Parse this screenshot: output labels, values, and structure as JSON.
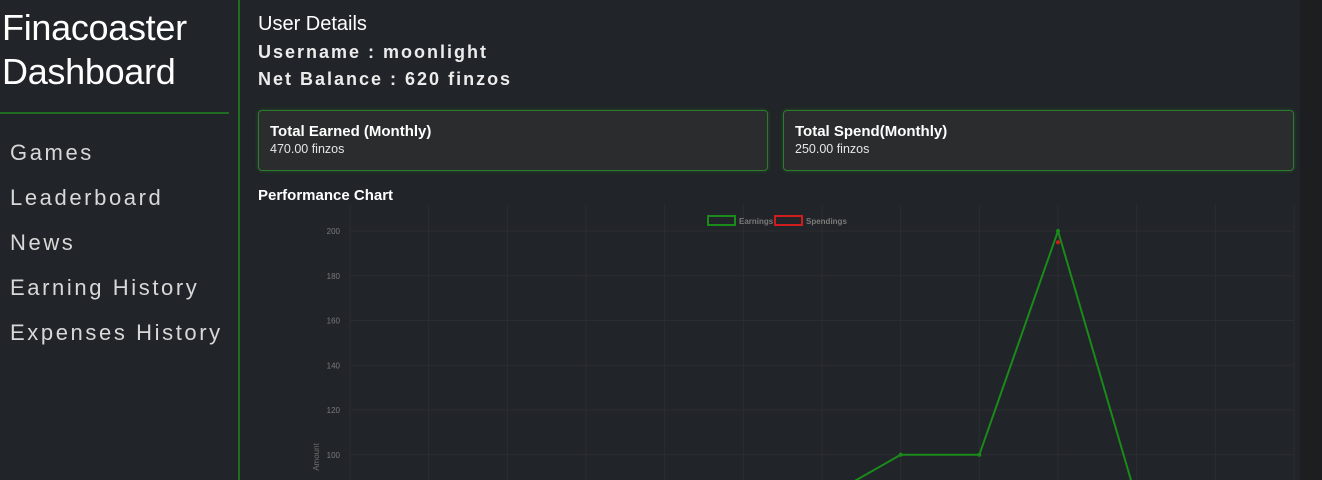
{
  "sidebar": {
    "brand_line1": "Finacoaster",
    "brand_line2": "Dashboard",
    "nav_items": [
      {
        "label": "Games"
      },
      {
        "label": "Leaderboard"
      },
      {
        "label": "News"
      },
      {
        "label": "Earning History"
      },
      {
        "label": "Expenses History"
      }
    ]
  },
  "user_details": {
    "title": "User Details",
    "username_line": "Username : moonlight",
    "balance_line": "Net Balance : 620 finzos"
  },
  "cards": {
    "earned": {
      "title": "Total Earned (Monthly)",
      "value": "470.00 finzos"
    },
    "spend": {
      "title": "Total Spend(Monthly)",
      "value": "250.00 finzos"
    }
  },
  "chart": {
    "title": "Performance Chart"
  },
  "colors": {
    "accent_green": "#1f6b1f",
    "earnings_line": "#1a8a1a",
    "spendings_line": "#d01c1c"
  },
  "chart_data": {
    "type": "line",
    "x": [
      0,
      1,
      2,
      3,
      4,
      5,
      6,
      7,
      8,
      9,
      10,
      11,
      12
    ],
    "series": [
      {
        "name": "Earnings",
        "values": [
          null,
          null,
          null,
          null,
          null,
          null,
          80,
          100,
          100,
          200,
          80,
          null,
          null
        ]
      },
      {
        "name": "Spendings",
        "values": [
          null,
          null,
          null,
          null,
          null,
          null,
          null,
          null,
          null,
          195,
          null,
          null,
          null
        ]
      }
    ],
    "y_ticks": [
      100,
      120,
      140,
      160,
      180,
      200
    ],
    "ylabel": "Amount",
    "ylim": [
      80,
      200
    ],
    "legend": "top-center",
    "grid": true
  }
}
